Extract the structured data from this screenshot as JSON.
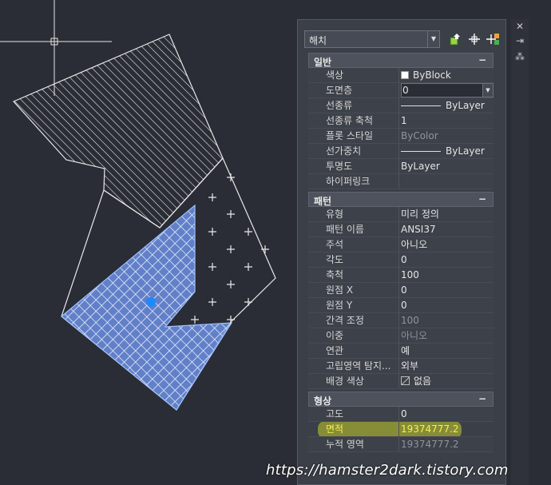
{
  "palette": {
    "object_type": "해치",
    "sections": [
      {
        "title": "일반",
        "toggle": "−",
        "rows": [
          {
            "label": "색상",
            "value": "ByBlock",
            "kind": "swatch"
          },
          {
            "label": "도면층",
            "value": "0",
            "kind": "editing"
          },
          {
            "label": "선종류",
            "value": "ByLayer",
            "kind": "line"
          },
          {
            "label": "선종류 축척",
            "value": "1"
          },
          {
            "label": "플롯 스타일",
            "value": "ByColor",
            "dim": true
          },
          {
            "label": "선가중치",
            "value": "ByLayer",
            "kind": "line"
          },
          {
            "label": "투명도",
            "value": "ByLayer"
          },
          {
            "label": "하이퍼링크",
            "value": ""
          }
        ]
      },
      {
        "title": "패턴",
        "toggle": "−",
        "rows": [
          {
            "label": "유형",
            "value": "미리 정의"
          },
          {
            "label": "패턴 이름",
            "value": "ANSI37"
          },
          {
            "label": "주석",
            "value": "아니오"
          },
          {
            "label": "각도",
            "value": "0"
          },
          {
            "label": "축척",
            "value": "100"
          },
          {
            "label": "원점 X",
            "value": "0"
          },
          {
            "label": "원점 Y",
            "value": "0"
          },
          {
            "label": "간격 조정",
            "value": "100",
            "dim": true
          },
          {
            "label": "이중",
            "value": "아니오",
            "dim": true
          },
          {
            "label": "연관",
            "value": "예"
          },
          {
            "label": "고립영역 탐지...",
            "value": "외부"
          },
          {
            "label": "배경 색상",
            "value": "없음",
            "kind": "slash"
          }
        ]
      },
      {
        "title": "형상",
        "toggle": "−",
        "rows": [
          {
            "label": "고도",
            "value": "0"
          },
          {
            "label": "면적",
            "value": "19374777.2",
            "dim": true,
            "highlight": true
          },
          {
            "label": "누적 영역",
            "value": "19374777.2",
            "dim": true
          }
        ]
      }
    ]
  },
  "strip_icons": [
    "close-icon",
    "pin-icon",
    "settings-icon"
  ],
  "toolbar_icons": [
    "quick-select-icon",
    "select-objects-icon",
    "pickadd-toggle-icon"
  ],
  "colors": {
    "selection_blue": "#4a8cff",
    "highlight_yellow": "#c6ce28",
    "canvas_bg": "#2a2d35"
  },
  "watermark": "https://hamster2dark.tistory.com"
}
